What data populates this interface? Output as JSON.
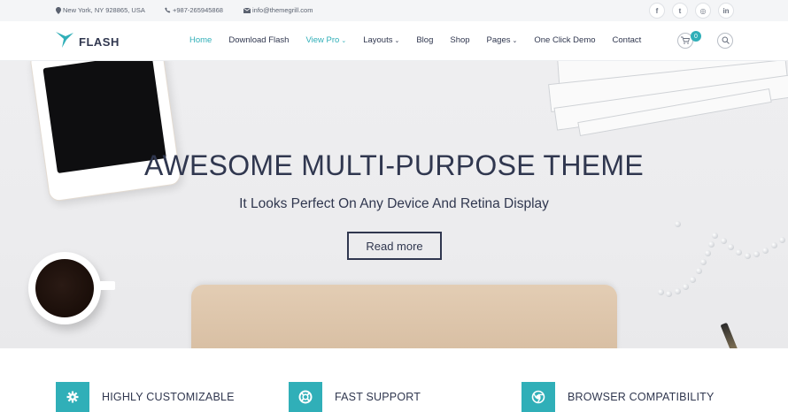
{
  "topbar": {
    "address": "New York, NY 928865, USA",
    "phone": "+987-265945868",
    "email": "info@themegrill.com",
    "social": [
      {
        "icon": "facebook-icon",
        "glyph": "f"
      },
      {
        "icon": "twitter-icon",
        "glyph": "t"
      },
      {
        "icon": "instagram-icon",
        "glyph": "◎"
      },
      {
        "icon": "linkedin-icon",
        "glyph": "in"
      }
    ]
  },
  "header": {
    "logo_text": "FLASH",
    "nav": [
      {
        "label": "Home",
        "active": true
      },
      {
        "label": "Download Flash"
      },
      {
        "label": "View Pro",
        "chevron": "⌄"
      },
      {
        "label": "Layouts",
        "chevron": "⌄"
      },
      {
        "label": "Blog"
      },
      {
        "label": "Shop"
      },
      {
        "label": "Pages",
        "chevron": "⌄"
      },
      {
        "label": "One Click Demo"
      },
      {
        "label": "Contact"
      }
    ],
    "cart_count": "0"
  },
  "hero": {
    "title": "AWESOME MULTI-PURPOSE THEME",
    "subtitle": "It Looks Perfect On Any Device And Retina Display",
    "button": "Read more"
  },
  "features": [
    {
      "icon": "gear-icon",
      "label": "HIGHLY CUSTOMIZABLE"
    },
    {
      "icon": "lifebuoy-icon",
      "label": "FAST SUPPORT"
    },
    {
      "icon": "chrome-icon",
      "label": "BROWSER COMPATIBILITY"
    }
  ],
  "colors": {
    "accent": "#30afb8",
    "text": "#30374f"
  }
}
